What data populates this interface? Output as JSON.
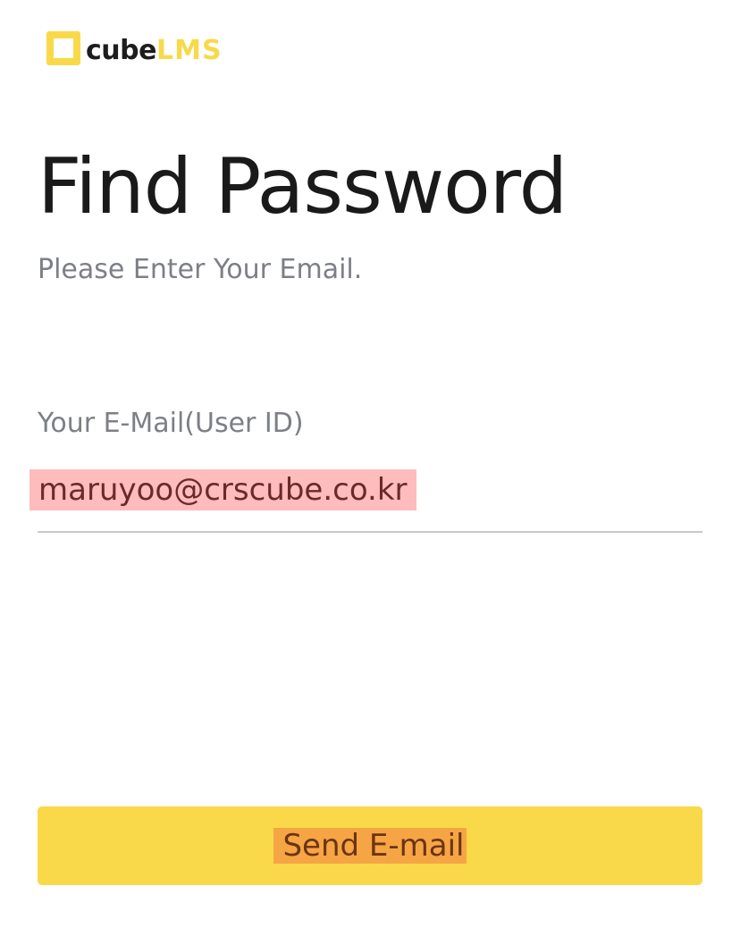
{
  "logo": {
    "text_primary": "cube",
    "text_accent": "LMS",
    "accent_color": "#f9d949"
  },
  "page": {
    "title": "Find Password",
    "subtitle": "Please Enter Your Email."
  },
  "form": {
    "email_label": "Your E-Mail(User ID)",
    "email_value": "maruyoo@crscube.co.kr"
  },
  "actions": {
    "send_label": "Send E-mail",
    "button_color": "#f9d949"
  }
}
